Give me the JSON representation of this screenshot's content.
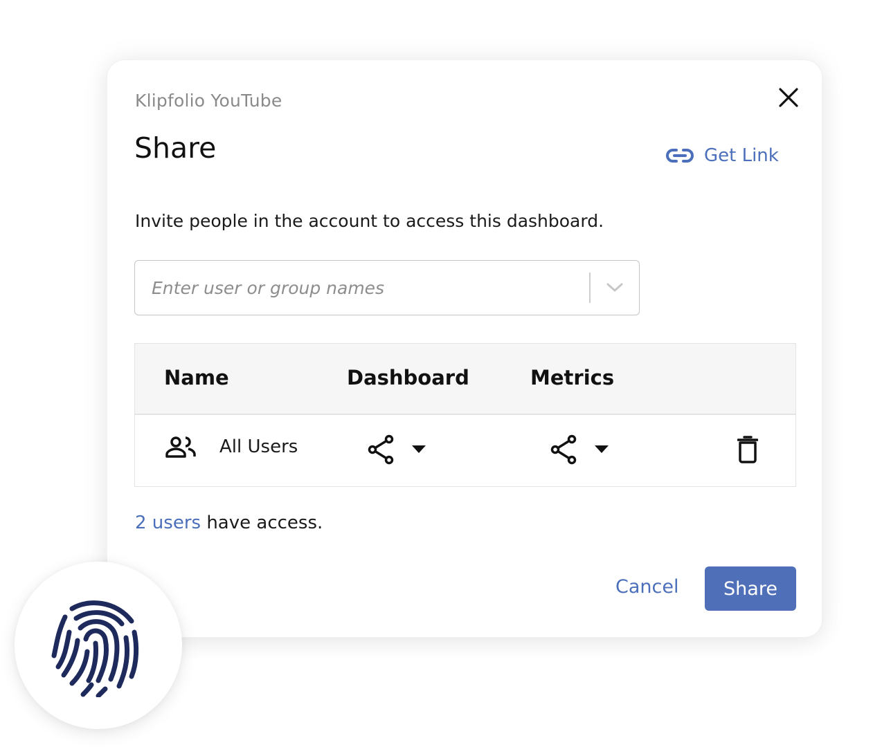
{
  "dialog": {
    "subtitle": "Klipfolio YouTube",
    "title": "Share",
    "close_icon": "close-icon",
    "get_link": {
      "label": "Get Link",
      "icon": "link-icon"
    },
    "instructions": "Invite people in the account to access this dashboard.",
    "invite_input": {
      "value": "",
      "placeholder": "Enter user or group names",
      "dropdown_icon": "chevron-down-icon"
    },
    "table": {
      "columns": [
        "Name",
        "Dashboard",
        "Metrics"
      ],
      "rows": [
        {
          "icon": "group-icon",
          "name": "All Users",
          "dashboard_permission_icon": "share-icon",
          "metrics_permission_icon": "share-icon",
          "delete_icon": "trash-icon"
        }
      ]
    },
    "access_summary": {
      "link_text": "2 users",
      "rest_text": " have access."
    },
    "buttons": {
      "cancel": "Cancel",
      "share": "Share"
    }
  },
  "badge": {
    "icon": "fingerprint-icon"
  },
  "colors": {
    "accent": "#4b6fba",
    "primary_button": "#4f6fb8",
    "fingerprint": "#1f2a5c",
    "header_bg": "#f6f6f6"
  }
}
